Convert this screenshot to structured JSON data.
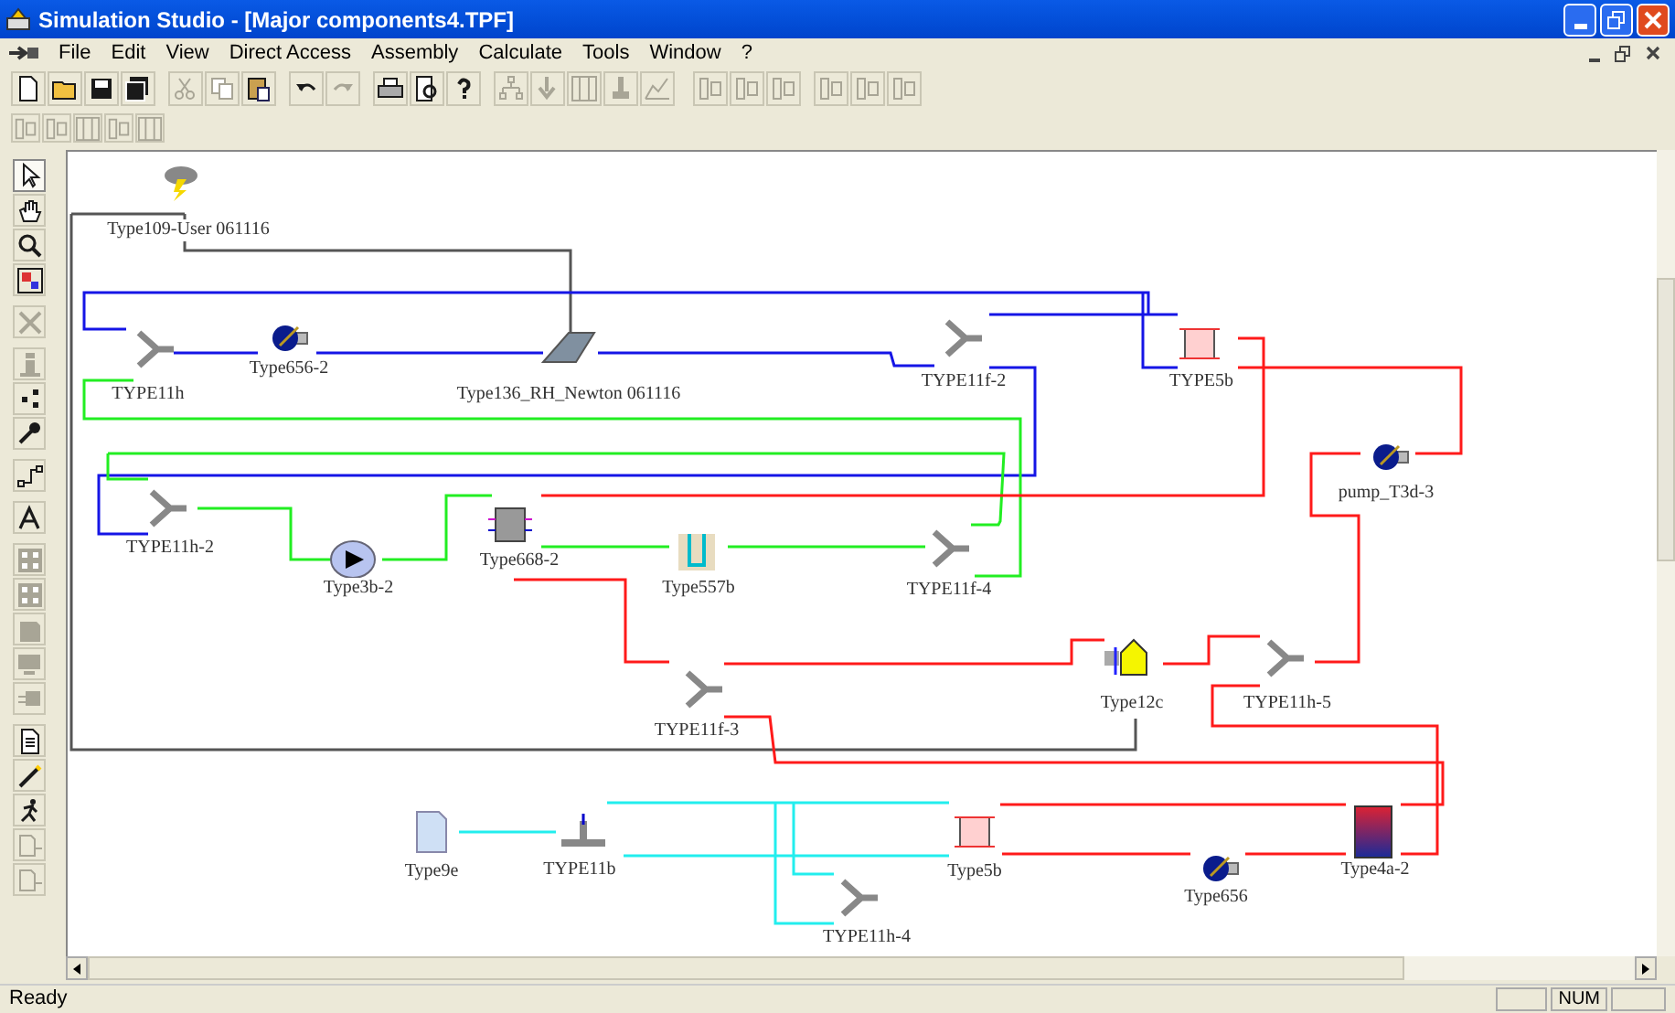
{
  "window": {
    "title": "Simulation Studio - [Major components4.TPF]"
  },
  "menu_bar": [
    "File",
    "Edit",
    "View",
    "Direct Access",
    "Assembly",
    "Calculate",
    "Tools",
    "Window",
    "?"
  ],
  "toolbar_1": [
    {
      "disabled": false
    },
    {
      "disabled": false
    },
    {
      "disabled": false
    },
    {
      "disabled": false
    },
    {
      "disabled": true
    },
    {
      "disabled": true
    },
    {
      "disabled": false
    },
    {
      "disabled": false
    },
    {
      "disabled": true
    },
    {
      "disabled": false
    },
    {
      "disabled": false
    },
    {
      "disabled": false
    },
    {
      "disabled": true
    },
    {
      "disabled": true
    },
    {
      "disabled": true
    },
    {
      "disabled": true
    },
    {
      "disabled": true
    },
    {
      "disabled": true
    },
    {
      "disabled": true
    },
    {
      "disabled": true
    },
    {
      "disabled": true
    },
    {
      "disabled": true
    },
    {
      "disabled": true
    }
  ],
  "toolbar_2": [
    {
      "disabled": true
    },
    {
      "disabled": true
    },
    {
      "disabled": true
    },
    {
      "disabled": true
    },
    {
      "disabled": true
    }
  ],
  "side_toolbar": [
    {
      "selected": true,
      "disabled": false
    },
    {
      "selected": false,
      "disabled": false
    },
    {
      "selected": false,
      "disabled": false
    },
    {
      "selected": false,
      "disabled": false
    },
    {
      "selected": false,
      "disabled": true
    },
    {
      "selected": false,
      "disabled": true
    },
    {
      "selected": false,
      "disabled": false
    },
    {
      "selected": false,
      "disabled": false
    },
    {
      "selected": false,
      "disabled": false
    },
    {
      "selected": false,
      "disabled": false
    },
    {
      "selected": false,
      "disabled": true
    },
    {
      "selected": false,
      "disabled": true
    },
    {
      "selected": false,
      "disabled": true
    },
    {
      "selected": false,
      "disabled": true
    },
    {
      "selected": false,
      "disabled": true
    },
    {
      "selected": false,
      "disabled": false
    },
    {
      "selected": false,
      "disabled": false
    },
    {
      "selected": false,
      "disabled": false
    },
    {
      "selected": false,
      "disabled": true
    },
    {
      "selected": false,
      "disabled": true
    }
  ],
  "components": [
    {
      "label": "Type109-User 061116",
      "kind": "weather"
    },
    {
      "label": "Type656-2",
      "kind": "pump"
    },
    {
      "label": "TYPE11h",
      "kind": "diverter"
    },
    {
      "label": "Type136_RH_Newton 061116",
      "kind": "collector"
    },
    {
      "label": "TYPE11f-2",
      "kind": "diverter"
    },
    {
      "label": "TYPE5b",
      "kind": "heat-exchanger"
    },
    {
      "label": "pump_T3d-3",
      "kind": "pump"
    },
    {
      "label": "TYPE11h-2",
      "kind": "diverter"
    },
    {
      "label": "Type3b-2",
      "kind": "circulator"
    },
    {
      "label": "Type668-2",
      "kind": "heat-pump"
    },
    {
      "label": "Type557b",
      "kind": "ground-exchanger"
    },
    {
      "label": "TYPE11f-4",
      "kind": "diverter"
    },
    {
      "label": "TYPE11f-3",
      "kind": "diverter"
    },
    {
      "label": "Type12c",
      "kind": "building"
    },
    {
      "label": "TYPE11h-5",
      "kind": "diverter"
    },
    {
      "label": "Type9e",
      "kind": "data-reader"
    },
    {
      "label": "TYPE11b",
      "kind": "tee"
    },
    {
      "label": "Type5b",
      "kind": "heat-exchanger"
    },
    {
      "label": "Type656",
      "kind": "pump"
    },
    {
      "label": "Type4a-2",
      "kind": "tank"
    },
    {
      "label": "TYPE11h-4",
      "kind": "diverter"
    }
  ],
  "status_bar": {
    "text": "Ready",
    "indicators": [
      "NUM"
    ]
  }
}
